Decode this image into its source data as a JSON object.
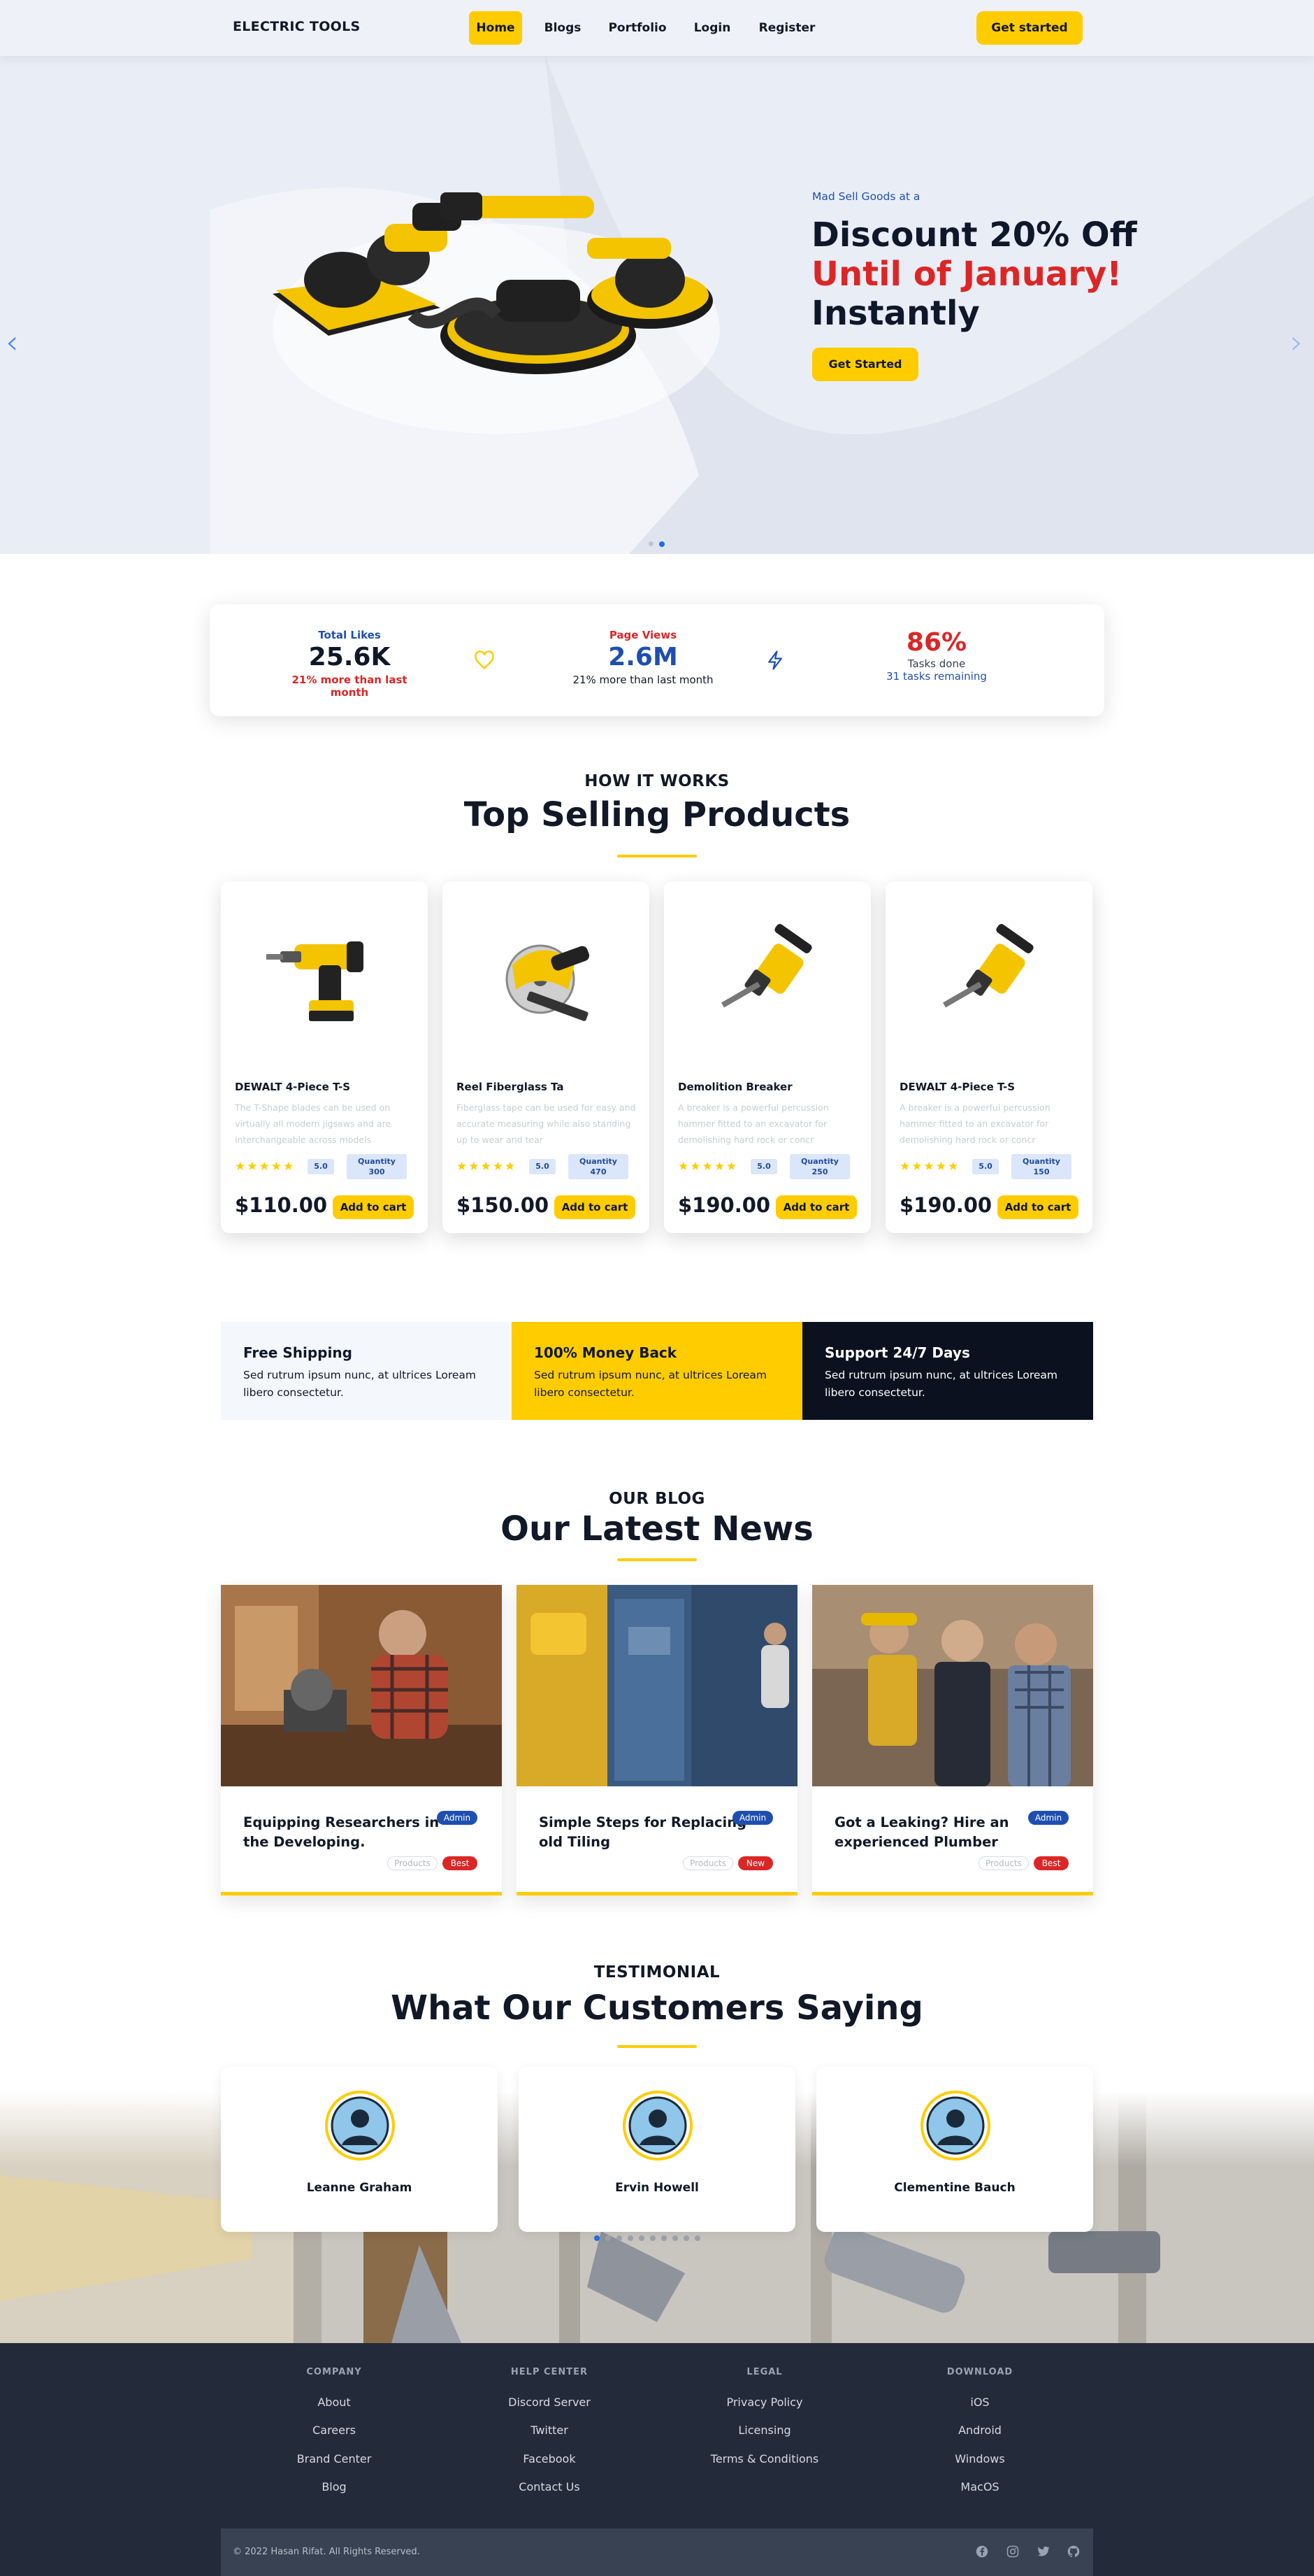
{
  "nav": {
    "brand": "ELECTRIC TOOLS",
    "links": [
      {
        "label": "Home",
        "active": true
      },
      {
        "label": "Blogs"
      },
      {
        "label": "Portfolio"
      },
      {
        "label": "Login"
      },
      {
        "label": "Register"
      }
    ],
    "cta": "Get started"
  },
  "hero": {
    "kicker": "Mad Sell Goods at a",
    "line1": "Discount 20% Off",
    "line2": "Until of January!",
    "line3": "Instantly",
    "cta": "Get Started",
    "accent_color": "#dc2626"
  },
  "stats": [
    {
      "label": "Total Likes",
      "value": "25.6K",
      "sub": "21% more than last month",
      "icon": "heart-icon"
    },
    {
      "label": "Page Views",
      "value": "2.6M",
      "sub": "21% more than last month",
      "icon": "bolt-icon"
    },
    {
      "value": "86%",
      "sub": "Tasks done",
      "sub2": "31 tasks remaining"
    }
  ],
  "products_section": {
    "kicker": "HOW IT WORKS",
    "title": "Top Selling Products"
  },
  "products": [
    {
      "name": "DEWALT 4-Piece T-S",
      "desc": "The T-Shape blades can be used on virtually all modern jigsaws and are interchangeable across models",
      "rating": "5.0",
      "qty_label": "Quantity",
      "qty": "300",
      "price": "$110.00",
      "cta": "Add to cart"
    },
    {
      "name": "Reel Fiberglass Ta",
      "desc": "Fiberglass tape can be used for easy and accurate measuring while also standing up to wear and tear",
      "rating": "5.0",
      "qty_label": "Quantity",
      "qty": "470",
      "price": "$150.00",
      "cta": "Add to cart"
    },
    {
      "name": "Demolition Breaker",
      "desc": "A breaker is a powerful percussion hammer fitted to an excavator for demolishing hard rock or concr",
      "rating": "5.0",
      "qty_label": "Quantity",
      "qty": "250",
      "price": "$190.00",
      "cta": "Add to cart"
    },
    {
      "name": "DEWALT 4-Piece T-S",
      "desc": "A breaker is a powerful percussion hammer fitted to an excavator for demolishing hard rock or concr",
      "rating": "5.0",
      "qty_label": "Quantity",
      "qty": "150",
      "price": "$190.00",
      "cta": "Add to cart"
    }
  ],
  "features": [
    {
      "title": "Free Shipping",
      "desc": "Sed rutrum ipsum nunc, at ultrices Loream libero consectetur."
    },
    {
      "title": "100% Money Back",
      "desc": "Sed rutrum ipsum nunc, at ultrices Loream libero consectetur."
    },
    {
      "title": "Support 24/7 Days",
      "desc": "Sed rutrum ipsum nunc, at ultrices Loream libero consectetur."
    }
  ],
  "blog_section": {
    "kicker": "OUR BLOG",
    "title": "Our Latest News"
  },
  "blog": [
    {
      "title": "Equipping Researchers in the Developing.",
      "author": "Admin",
      "category": "Products",
      "tag": "Best"
    },
    {
      "title": "Simple Steps for Replacing old Tiling",
      "author": "Admin",
      "category": "Products",
      "tag": "New"
    },
    {
      "title": "Got a Leaking? Hire an experienced Plumber",
      "author": "Admin",
      "category": "Products",
      "tag": "Best"
    }
  ],
  "testimonial_section": {
    "kicker": "TESTIMONIAL",
    "title": "What Our Customers Saying"
  },
  "testimonials": [
    {
      "name": "Leanne Graham"
    },
    {
      "name": "Ervin Howell"
    },
    {
      "name": "Clementine Bauch"
    }
  ],
  "footer": {
    "columns": [
      {
        "heading": "COMPANY",
        "links": [
          "About",
          "Careers",
          "Brand Center",
          "Blog"
        ]
      },
      {
        "heading": "HELP CENTER",
        "links": [
          "Discord Server",
          "Twitter",
          "Facebook",
          "Contact Us"
        ]
      },
      {
        "heading": "LEGAL",
        "links": [
          "Privacy Policy",
          "Licensing",
          "Terms & Conditions"
        ]
      },
      {
        "heading": "DOWNLOAD",
        "links": [
          "iOS",
          "Android",
          "Windows",
          "MacOS"
        ]
      }
    ],
    "copyright": "© 2022 Hasan Rifat. All Rights Reserved.",
    "social": [
      "facebook-icon",
      "instagram-icon",
      "twitter-icon",
      "github-icon"
    ]
  },
  "colors": {
    "brand_yellow": "#ffcc00",
    "navy": "#1e4fb0",
    "red": "#dc2626",
    "dark": "#0b111e",
    "footer": "#232b3a"
  }
}
